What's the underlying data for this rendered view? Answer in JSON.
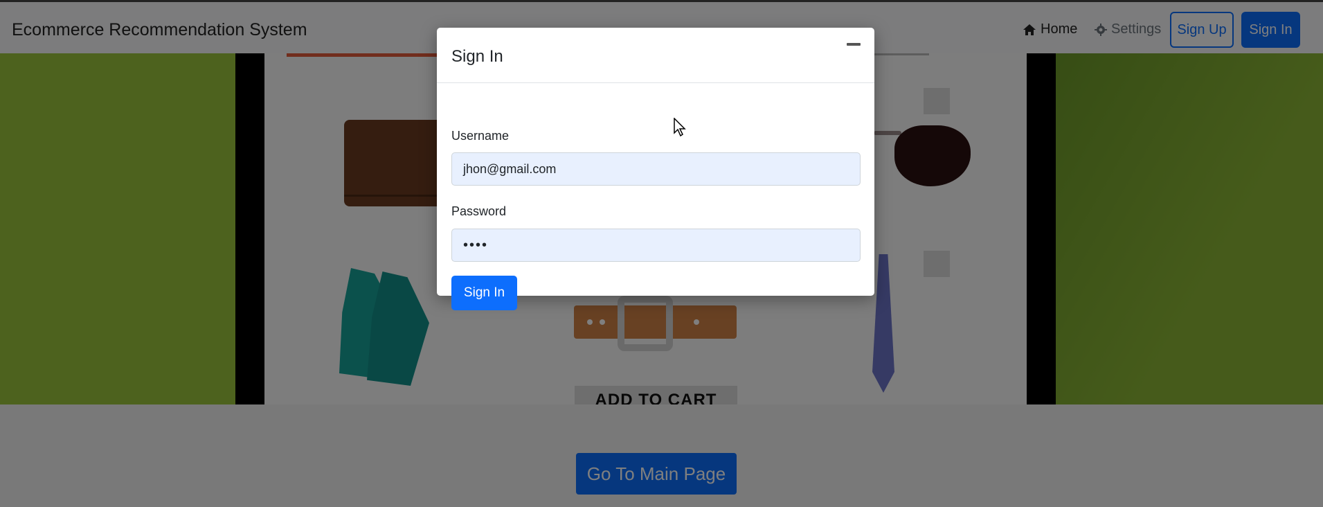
{
  "navbar": {
    "brand": "Ecommerce Recommendation System",
    "home_label": "Home",
    "settings_label": "Settings",
    "signup_label": "Sign Up",
    "signin_label": "Sign In"
  },
  "banner": {
    "add_to_cart_label": "ADD TO CART"
  },
  "main": {
    "go_main_label": "Go To Main Page"
  },
  "modal": {
    "title": "Sign In",
    "username_label": "Username",
    "username_value": "jhon@gmail.com",
    "password_label": "Password",
    "password_value": "••••",
    "submit_label": "Sign In"
  },
  "colors": {
    "primary": "#0d6efd",
    "banner_green": "#9bc53d",
    "input_bg": "#e8f0fe"
  }
}
